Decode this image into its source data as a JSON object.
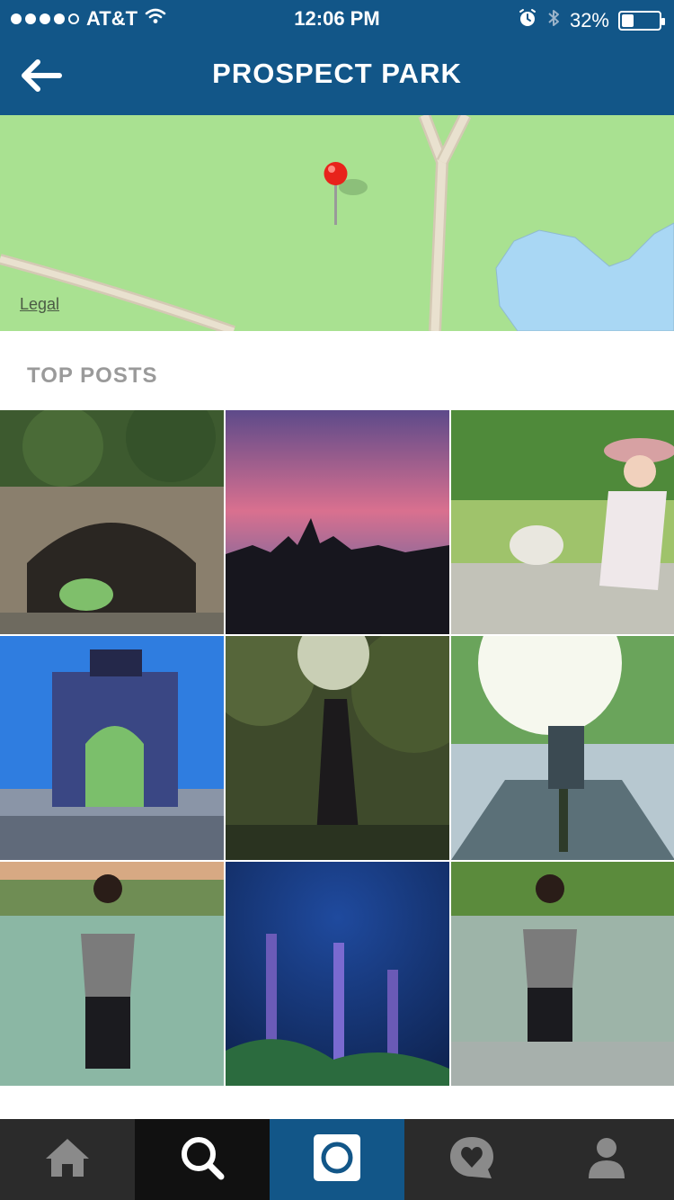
{
  "status_bar": {
    "carrier": "AT&T",
    "time": "12:06 PM",
    "battery": "32%",
    "battery_level": 0.32,
    "signal_bars_filled": 4,
    "signal_bars_total": 5,
    "icons": [
      "wifi-icon",
      "alarm-icon",
      "bluetooth-icon",
      "battery-icon"
    ]
  },
  "nav": {
    "title": "PROSPECT PARK",
    "back_icon": "back-arrow-icon"
  },
  "map": {
    "legal_label": "Legal",
    "pin_icon": "map-pin-icon"
  },
  "section": {
    "title": "TOP POSTS"
  },
  "posts": [
    {
      "subject": "stone-arch-tunnel"
    },
    {
      "subject": "pink-sunset-skyline"
    },
    {
      "subject": "woman-with-swan"
    },
    {
      "subject": "grand-army-arch"
    },
    {
      "subject": "pregnant-woman-forest"
    },
    {
      "subject": "cyclist-sunlight"
    },
    {
      "subject": "woman-by-lake"
    },
    {
      "subject": "lavender-flowers"
    },
    {
      "subject": "woman-by-lake-2"
    }
  ],
  "tabbar": {
    "items": [
      {
        "name": "home",
        "icon": "home-icon"
      },
      {
        "name": "explore",
        "icon": "search-icon"
      },
      {
        "name": "camera",
        "icon": "camera-icon"
      },
      {
        "name": "activity",
        "icon": "heart-bubble-icon"
      },
      {
        "name": "profile",
        "icon": "profile-icon"
      }
    ],
    "active": "explore"
  },
  "colors": {
    "header": "#125688",
    "map_green": "#a9e191",
    "water": "#a9d7f4",
    "section_label": "#9a9a9a",
    "tabbar_bg": "#2b2b2b"
  }
}
